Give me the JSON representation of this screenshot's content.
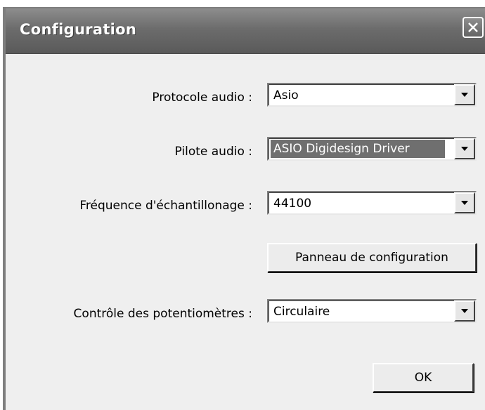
{
  "window": {
    "title": "Configuration",
    "close_icon": "close-icon"
  },
  "form": {
    "protocol": {
      "label": "Protocole audio :",
      "value": "Asio"
    },
    "driver": {
      "label": "Pilote audio :",
      "value": "ASIO Digidesign Driver"
    },
    "sample_rate": {
      "label": "Fréquence d'échantillonage :",
      "value": "44100"
    },
    "control_panel_button": "Panneau de configuration",
    "knob_control": {
      "label": "Contrôle des potentiomètres :",
      "value": "Circulaire"
    }
  },
  "buttons": {
    "ok": "OK"
  },
  "icons": {
    "dropdown": "chevron-down-icon"
  },
  "colors": {
    "titlebar": "#6c6c6c",
    "dialog_bg": "#efefef",
    "selected_value_bg": "#6f6f6f"
  }
}
